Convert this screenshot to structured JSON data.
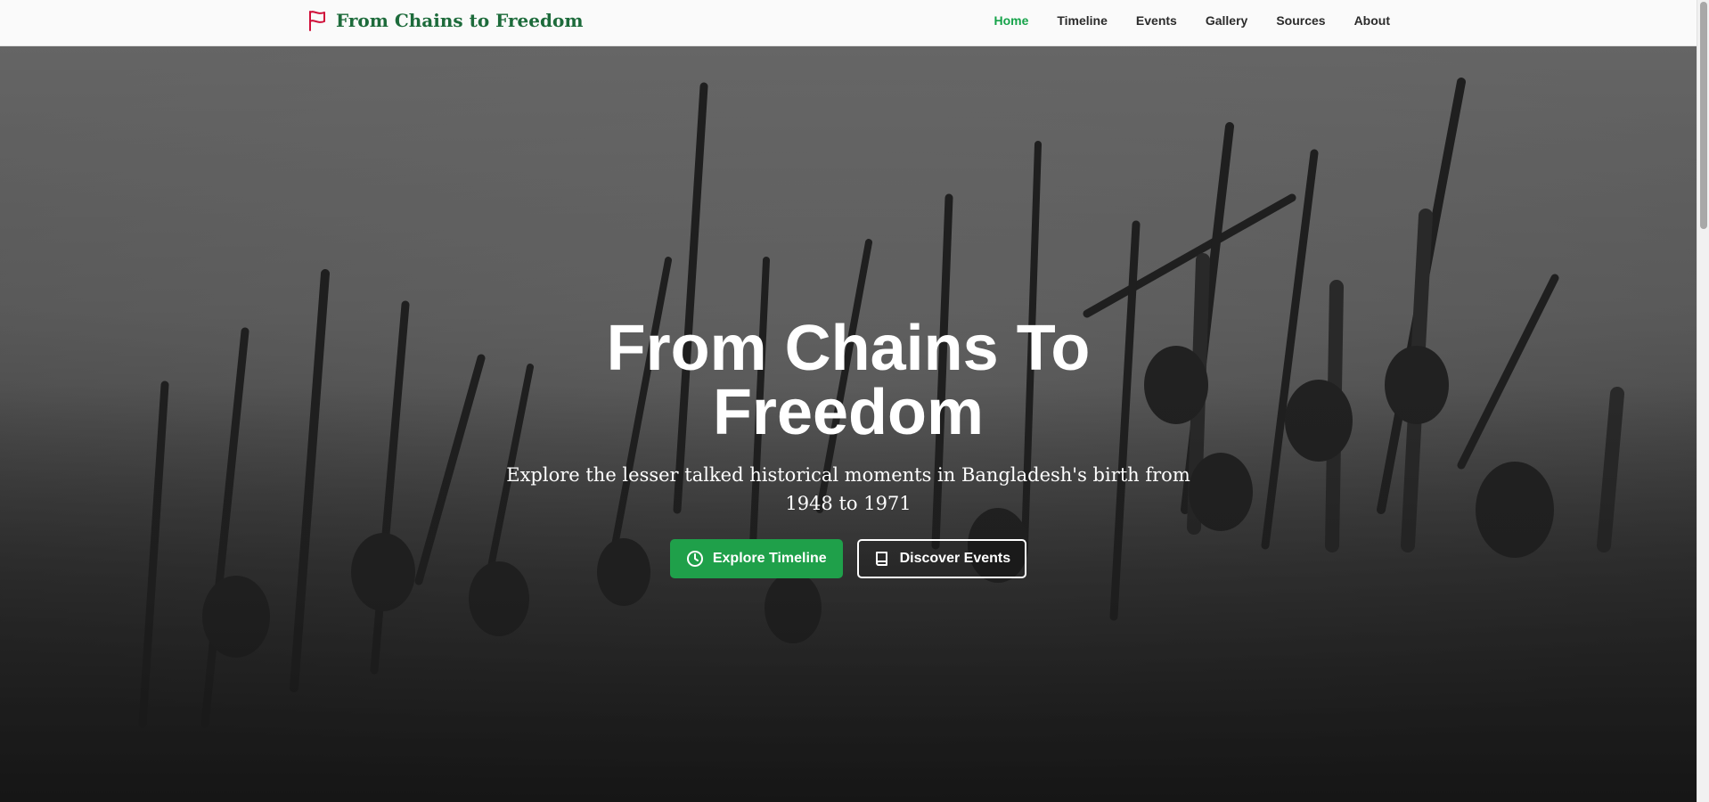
{
  "brand": {
    "title": "From Chains to Freedom",
    "icon": "flag-icon"
  },
  "nav": {
    "items": [
      {
        "label": "Home",
        "active": true
      },
      {
        "label": "Timeline",
        "active": false
      },
      {
        "label": "Events",
        "active": false
      },
      {
        "label": "Gallery",
        "active": false
      },
      {
        "label": "Sources",
        "active": false
      },
      {
        "label": "About",
        "active": false
      }
    ]
  },
  "hero": {
    "title": "From Chains To Freedom",
    "subtitle": "Explore the lesser talked historical moments in Bangladesh's birth from 1948 to 1971",
    "primary_button": {
      "label": "Explore Timeline",
      "icon": "clock-icon"
    },
    "secondary_button": {
      "label": "Discover Events",
      "icon": "book-icon"
    }
  },
  "colors": {
    "brand_green": "#1d6b3b",
    "accent_green": "#16a34a",
    "button_green": "#1fa04a",
    "flag_red": "#d0103a"
  }
}
